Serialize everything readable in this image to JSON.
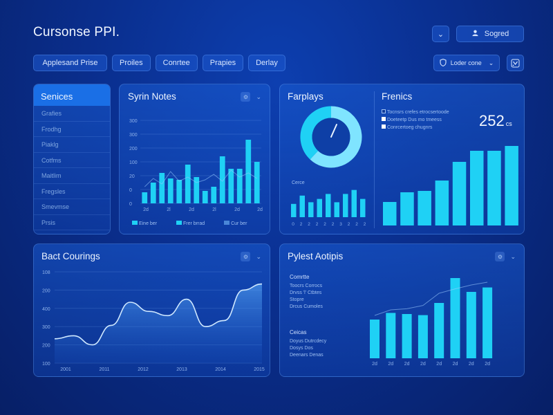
{
  "app": {
    "title": "Cursonse PPI."
  },
  "header": {
    "chevron_icon_glyph": "⌄",
    "user_label": "Sogred",
    "tabs": [
      "Applesand Prise",
      "Proiles",
      "Conrtee",
      "Prapies",
      "Derlay"
    ],
    "filter_label": "Loder cone",
    "filter_chevron": "⌄"
  },
  "colors": {
    "background": "#0a2f8f",
    "panel": "#1a5cd2",
    "accent": "#1fd1f5",
    "accent_soft": "#7fe4ff",
    "sidebar_header": "#1a6fe6"
  },
  "services": {
    "title": "Senices",
    "items": [
      "Grafies",
      "Frodhg",
      "Piaklg",
      "Cotfms",
      "Maitlim",
      "Fregsles",
      "Smevmse",
      "Prsis"
    ]
  },
  "panel_syrin": {
    "title": "Syrin Notes",
    "tool_chevron": "⌄",
    "legend": [
      "Eine ber",
      "Frer brrad",
      "Cur ber"
    ]
  },
  "panel_farplays": {
    "title": "Farplays",
    "sub_label": "Cerce"
  },
  "panel_frenics": {
    "title": "Frenics",
    "big_value": "252",
    "big_value_suffix": "cs",
    "legend": [
      "Tocnsrs crefes etrocsertoode",
      "Doeteetp Dus mo tmeess",
      "Conrcertoeg chugnrs"
    ]
  },
  "panel_bact": {
    "title": "Bact Courings",
    "tool_chevron": "⌄"
  },
  "panel_pylest": {
    "title": "Pylest Aotipis",
    "tool_chevron": "⌄",
    "group1_title": "Comrtte",
    "group1_items": [
      "Toocrs Corrocs",
      "Drvss 'l' Ctbtes",
      "Stopre",
      "Drcus Cumoles"
    ],
    "group2_title": "Ceicas",
    "group2_items": [
      "Doyus Dutrcdecy",
      "Dosys Dos",
      "Deenars Denas"
    ]
  },
  "chart_data": [
    {
      "id": "syrin",
      "type": "bar",
      "categories": [
        "2d",
        "2l",
        "2d",
        "2l",
        "2d",
        "2d"
      ],
      "values": [
        40,
        75,
        110,
        90,
        85,
        140,
        95,
        45,
        60,
        170,
        125,
        125,
        230,
        150
      ],
      "line": [
        60,
        90,
        70,
        115,
        80,
        95,
        75,
        85,
        105,
        80,
        120,
        95,
        110,
        90
      ],
      "yticks": [
        "0",
        "0",
        "20",
        "100",
        "200",
        "300",
        "300"
      ],
      "ylim": [
        0,
        300
      ]
    },
    {
      "id": "farplays_donut",
      "type": "pie",
      "values": [
        62,
        38
      ],
      "colors": [
        "#7fe4ff",
        "#1fd1f5"
      ]
    },
    {
      "id": "farplays_bars",
      "type": "bar",
      "categories": [
        "0",
        "2",
        "2",
        "2",
        "2",
        "2",
        "3",
        "2",
        "2",
        "2"
      ],
      "values": [
        40,
        65,
        45,
        55,
        70,
        45,
        70,
        82,
        55
      ],
      "ylim": [
        0,
        100
      ]
    },
    {
      "id": "frenics",
      "type": "bar",
      "values": [
        34,
        48,
        50,
        65,
        92,
        108,
        108,
        115
      ],
      "ylim": [
        0,
        120
      ]
    },
    {
      "id": "bact",
      "type": "area",
      "categories": [
        "2001",
        "2011",
        "2012",
        "2013",
        "2014",
        "2015"
      ],
      "values": [
        40,
        45,
        30,
        62,
        100,
        85,
        78,
        105,
        60,
        70,
        120,
        130
      ],
      "yticks": [
        "108",
        "200",
        "400",
        "300",
        "200",
        "100"
      ],
      "ylim": [
        0,
        150
      ]
    },
    {
      "id": "pylest",
      "type": "bar",
      "categories": [
        "2d",
        "2d",
        "2d",
        "2d",
        "2d",
        "2d",
        "2d",
        "2d"
      ],
      "values": [
        70,
        82,
        80,
        78,
        100,
        145,
        120,
        128
      ],
      "line": [
        70,
        80,
        82,
        88,
        110,
        118,
        125,
        130
      ],
      "ylim": [
        0,
        150
      ]
    }
  ]
}
